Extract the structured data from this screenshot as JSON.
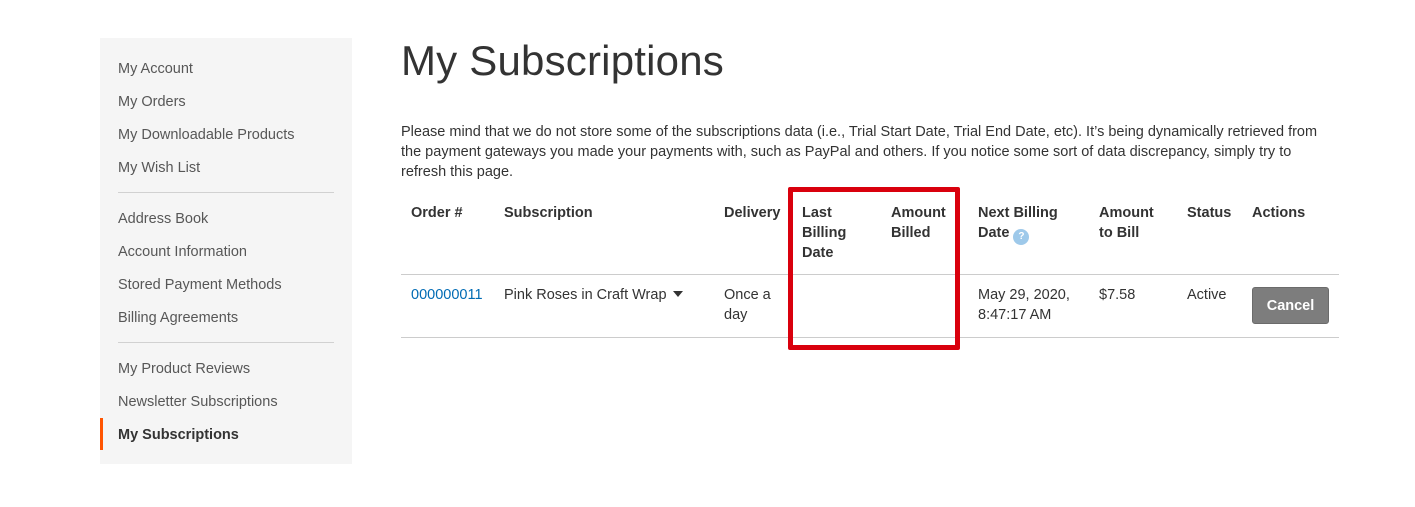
{
  "sidebar": {
    "items": [
      {
        "label": "My Account"
      },
      {
        "label": "My Orders"
      },
      {
        "label": "My Downloadable Products"
      },
      {
        "label": "My Wish List"
      },
      {
        "label": "Address Book"
      },
      {
        "label": "Account Information"
      },
      {
        "label": "Stored Payment Methods"
      },
      {
        "label": "Billing Agreements"
      },
      {
        "label": "My Product Reviews"
      },
      {
        "label": "Newsletter Subscriptions"
      },
      {
        "label": "My Subscriptions",
        "active": true
      }
    ],
    "accent_color": "#ff5501"
  },
  "page": {
    "title": "My Subscriptions",
    "notice": "Please mind that we do not store some of the subscriptions data (i.e., Trial Start Date, Trial End Date, etc). It’s being dynamically retrieved from the payment gateways you made your payments with, such as PayPal and others. If you notice some sort of data discrepancy, simply try to refresh this page."
  },
  "table": {
    "columns": {
      "order": "Order #",
      "subscription": "Subscription",
      "delivery": "Delivery",
      "last_billing": "Last Billing Date",
      "amount_billed": "Amount Billed",
      "next_billing": "Next Billing Date",
      "amount_to_bill": "Amount to Bill",
      "status": "Status",
      "actions": "Actions"
    },
    "next_billing_help_icon": "?",
    "rows": [
      {
        "order": "000000011",
        "subscription": "Pink Roses in Craft Wrap",
        "delivery": "Once a day",
        "last_billing": "",
        "amount_billed": "",
        "next_billing": "May 29, 2020, 8:47:17 AM",
        "amount_to_bill": "$7.58",
        "status": "Active",
        "action_label": "Cancel"
      }
    ]
  },
  "colors": {
    "link": "#006bb4",
    "highlight_border": "#d9000d",
    "cancel_button": "#7d7d7d",
    "help_icon": "#9ec9ea"
  }
}
